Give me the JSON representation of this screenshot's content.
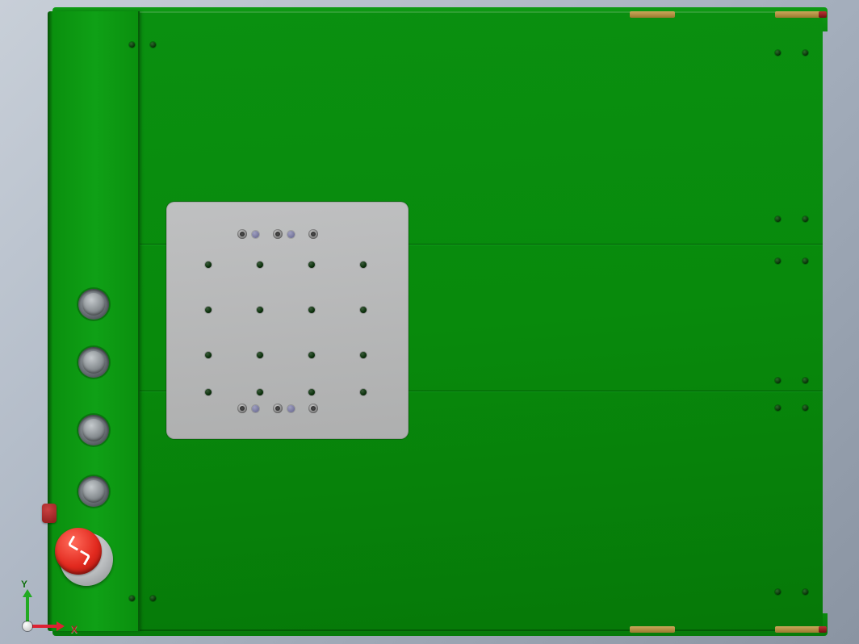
{
  "axes": {
    "x": "X",
    "y": "Y"
  },
  "icons": {
    "pushbutton": "pushbutton-icon",
    "estop": "emergency-stop-icon",
    "triad": "axis-triad-icon"
  },
  "colors": {
    "body": "#0a900e",
    "plate": "#b6b7b8",
    "estop": "#e22a1f",
    "amber": "#caa75a"
  }
}
